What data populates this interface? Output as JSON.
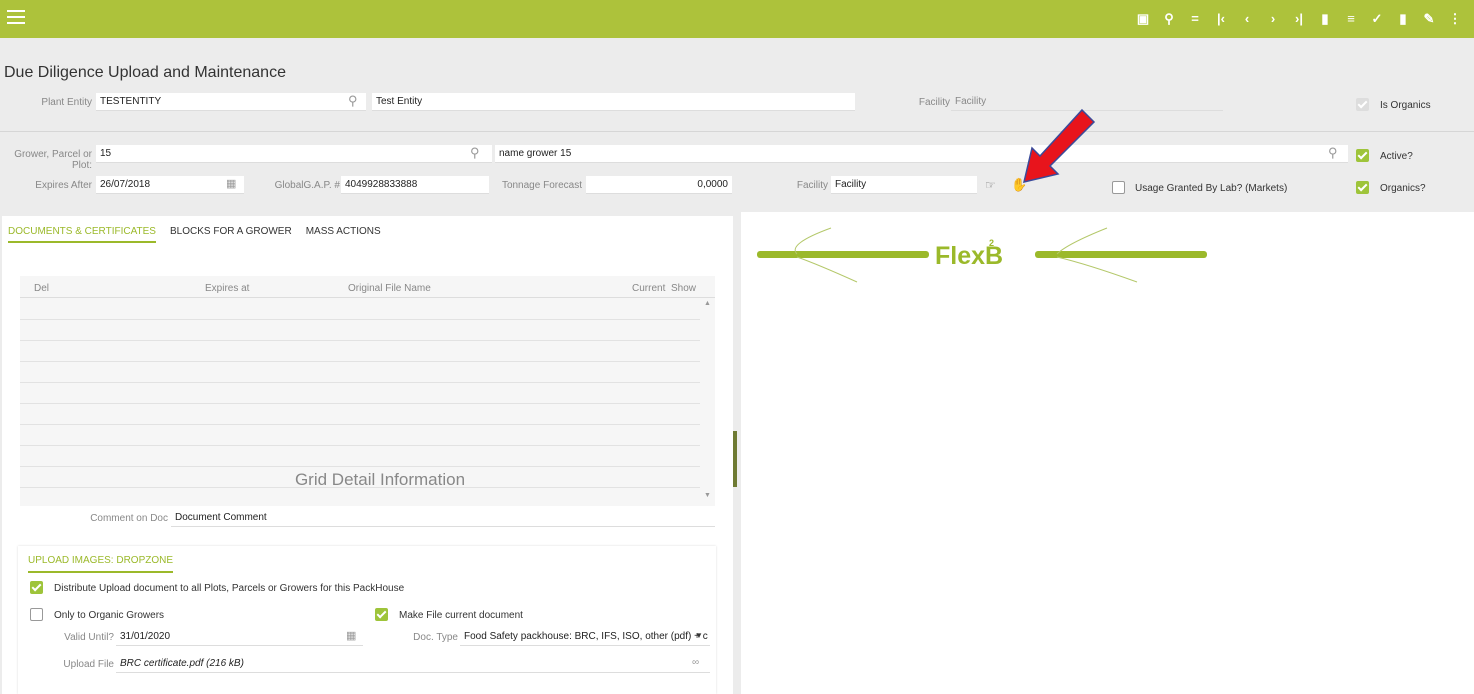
{
  "toolbar": {
    "menu_icon": "hamburger-icon",
    "icons": [
      "calendar-icon",
      "search-icon",
      "equals-icon",
      "first-icon",
      "prev-icon",
      "next-icon",
      "last-icon",
      "new-doc-icon",
      "list-icon",
      "check-icon",
      "trash-icon",
      "wrench-icon",
      "more-vert-icon"
    ],
    "glyphs": [
      "▣",
      "⚲",
      "=",
      "|‹",
      "‹",
      "›",
      "›|",
      "▮",
      "≡",
      "✓",
      "▮",
      "✎",
      "⋮"
    ]
  },
  "page": {
    "title": "Due Diligence Upload and Maintenance"
  },
  "header": {
    "plant_entity_label": "Plant Entity",
    "plant_entity_value": "TESTENTITY",
    "plant_entity_name": "Test Entity",
    "facility_label": "Facility",
    "facility_value": "Facility",
    "is_organics_label": "Is Organics"
  },
  "grower": {
    "label_line1": "Grower, Parcel or",
    "label_line2": "Plot:",
    "code": "15",
    "name": "name grower 15",
    "active_label": "Active?",
    "expires_after_label": "Expires After",
    "expires_after_value": "26/07/2018",
    "globalgap_label": "GlobalG.A.P. #",
    "globalgap_value": "4049928833888",
    "tonnage_label": "Tonnage Forecast",
    "tonnage_value": "0,0000",
    "facility_label": "Facility",
    "facility_value": "Facility",
    "usage_lab_label": "Usage Granted By Lab? (Markets)",
    "organics_label": "Organics?"
  },
  "tabs": [
    "DOCUMENTS & CERTIFICATES",
    "BLOCKS FOR A GROWER",
    "MASS ACTIONS"
  ],
  "grid": {
    "columns": [
      "Del",
      "Expires at",
      "Original File Name",
      "Current",
      "Show"
    ],
    "empty_message": "Grid Detail Information"
  },
  "comment": {
    "label": "Comment on Doc",
    "value": "Document Comment"
  },
  "dropzone": {
    "title": "UPLOAD IMAGES: DROPZONE",
    "distribute_label": "Distribute Upload document to all Plots, Parcels or Growers for this PackHouse",
    "organic_only_label": "Only to Organic Growers",
    "make_current_label": "Make File current document",
    "valid_until_label": "Valid Until?",
    "valid_until_value": "31/01/2020",
    "doc_type_label": "Doc. Type",
    "doc_type_value": "Food Safety packhouse: BRC, IFS, ISO, other (pdf) + c",
    "upload_file_label": "Upload File",
    "upload_file_value": "BRC certificate.pdf (216 kB)"
  },
  "logo": {
    "text": "FlexB",
    "superscript": "2"
  },
  "colors": {
    "brand": "#adc23b",
    "accent": "#9bb92a",
    "arrow": "#e8141c"
  }
}
